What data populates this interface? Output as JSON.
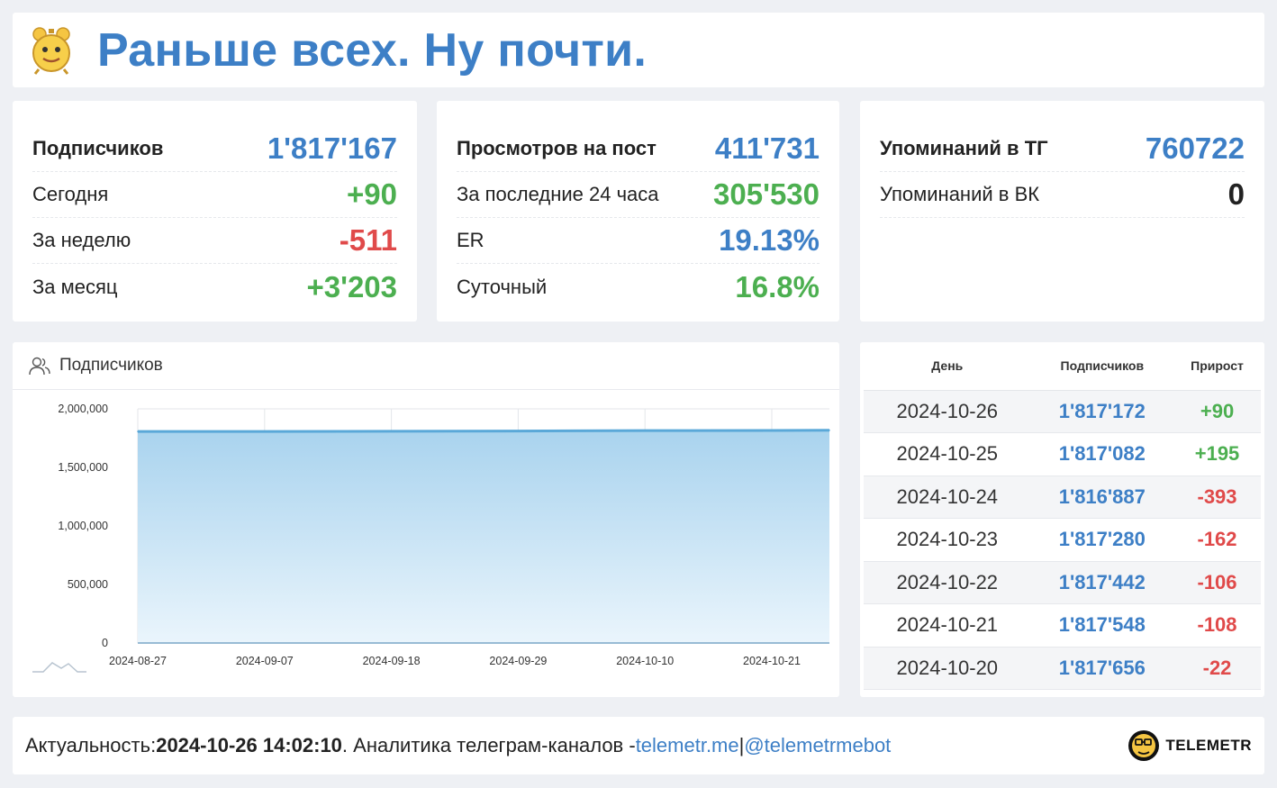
{
  "header": {
    "title": "Раньше всех. Ну почти."
  },
  "subscribers": {
    "rows": [
      {
        "label": "Подписчиков",
        "value": "1'817'167",
        "color": "#3d7fc6"
      },
      {
        "label": "Сегодня",
        "value": "+90",
        "color": "#4caf50"
      },
      {
        "label": "За неделю",
        "value": "-511",
        "color": "#e04a4a"
      },
      {
        "label": "За месяц",
        "value": "+3'203",
        "color": "#4caf50"
      }
    ]
  },
  "views": {
    "rows": [
      {
        "label": "Просмотров на пост",
        "value": "411'731",
        "color": "#3d7fc6"
      },
      {
        "label": "За последние 24 часа",
        "value": "305'530",
        "color": "#4caf50"
      },
      {
        "label": "ER",
        "value": "19.13%",
        "color": "#3d7fc6"
      },
      {
        "label": "Суточный",
        "value": "16.8%",
        "color": "#4caf50"
      }
    ]
  },
  "mentions": {
    "rows": [
      {
        "label": "Упоминаний в ТГ",
        "value": "760722",
        "color": "#3d7fc6"
      },
      {
        "label": "Упоминаний в ВК",
        "value": "0",
        "color": "#222222"
      }
    ]
  },
  "chart_panel": {
    "title": "Подписчиков",
    "icon": "users-icon"
  },
  "chart_data": {
    "type": "area",
    "title": "Подписчиков",
    "x": [
      "2024-08-27",
      "2024-09-07",
      "2024-09-18",
      "2024-09-29",
      "2024-10-10",
      "2024-10-21",
      "2024-10-26"
    ],
    "values": [
      1807000,
      1806500,
      1809000,
      1811000,
      1814000,
      1815500,
      1817167
    ],
    "x_ticks": [
      "2024-08-27",
      "2024-09-07",
      "2024-09-18",
      "2024-09-29",
      "2024-10-10",
      "2024-10-21"
    ],
    "y_ticks": [
      "2,000,000",
      "1,500,000",
      "1,000,000",
      "500,000",
      "0"
    ],
    "ylim": [
      0,
      2000000
    ],
    "grid": true,
    "color": "#5aa8d8"
  },
  "table": {
    "headers": {
      "day": "День",
      "subs": "Подписчиков",
      "growth": "Прирост"
    },
    "rows": [
      {
        "day": "2024-10-26",
        "subs": "1'817'172",
        "growth": "+90",
        "color": "#4caf50"
      },
      {
        "day": "2024-10-25",
        "subs": "1'817'082",
        "growth": "+195",
        "color": "#4caf50"
      },
      {
        "day": "2024-10-24",
        "subs": "1'816'887",
        "growth": "-393",
        "color": "#e04a4a"
      },
      {
        "day": "2024-10-23",
        "subs": "1'817'280",
        "growth": "-162",
        "color": "#e04a4a"
      },
      {
        "day": "2024-10-22",
        "subs": "1'817'442",
        "growth": "-106",
        "color": "#e04a4a"
      },
      {
        "day": "2024-10-21",
        "subs": "1'817'548",
        "growth": "-108",
        "color": "#e04a4a"
      },
      {
        "day": "2024-10-20",
        "subs": "1'817'656",
        "growth": "-22",
        "color": "#e04a4a"
      }
    ]
  },
  "footer": {
    "prefix": "Актуальность: ",
    "datetime": "2024-10-26 14:02:10",
    "mid": ". Аналитика телеграм-каналов - ",
    "link1": "telemetr.me",
    "sep": " | ",
    "link2": "@telemetrmebot",
    "brand": "TELEMETR"
  }
}
